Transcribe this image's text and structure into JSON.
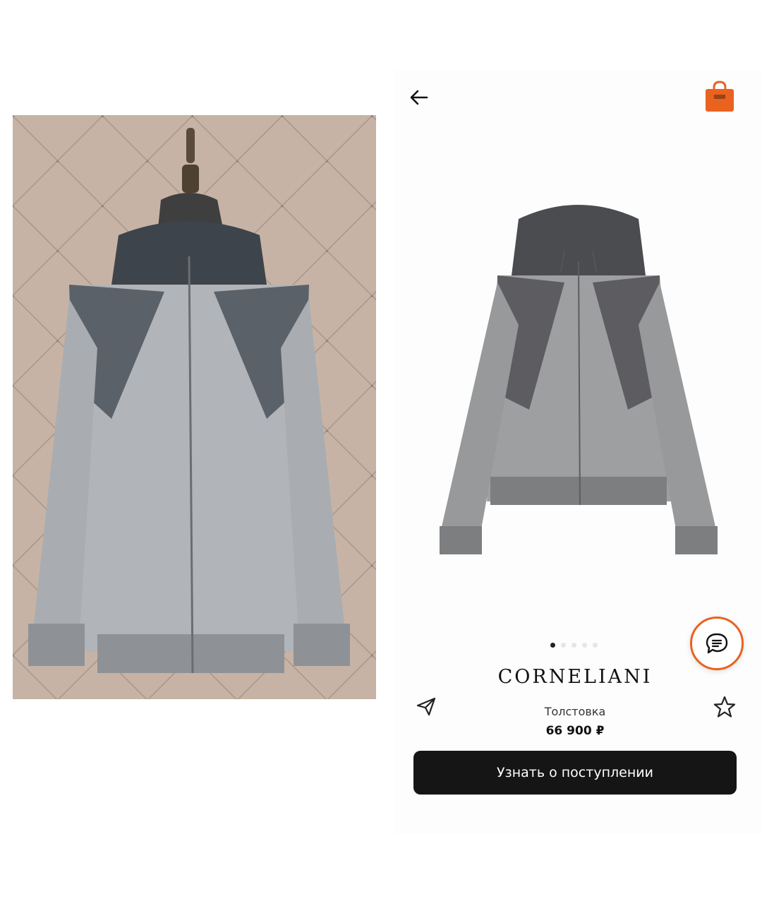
{
  "product": {
    "brand": "CORNELIANI",
    "category": "Толстовка",
    "price": "66 900 ₽"
  },
  "actions": {
    "notify_label": "Узнать о поступлении"
  },
  "carousel": {
    "count": 5,
    "active_index": 0
  },
  "icons": {
    "back": "arrow-left-icon",
    "cart": "shopping-bag-icon",
    "chat": "chat-icon",
    "share": "paper-plane-icon",
    "favorite": "star-icon"
  },
  "colors": {
    "accent": "#e9631f",
    "button": "#151515"
  }
}
